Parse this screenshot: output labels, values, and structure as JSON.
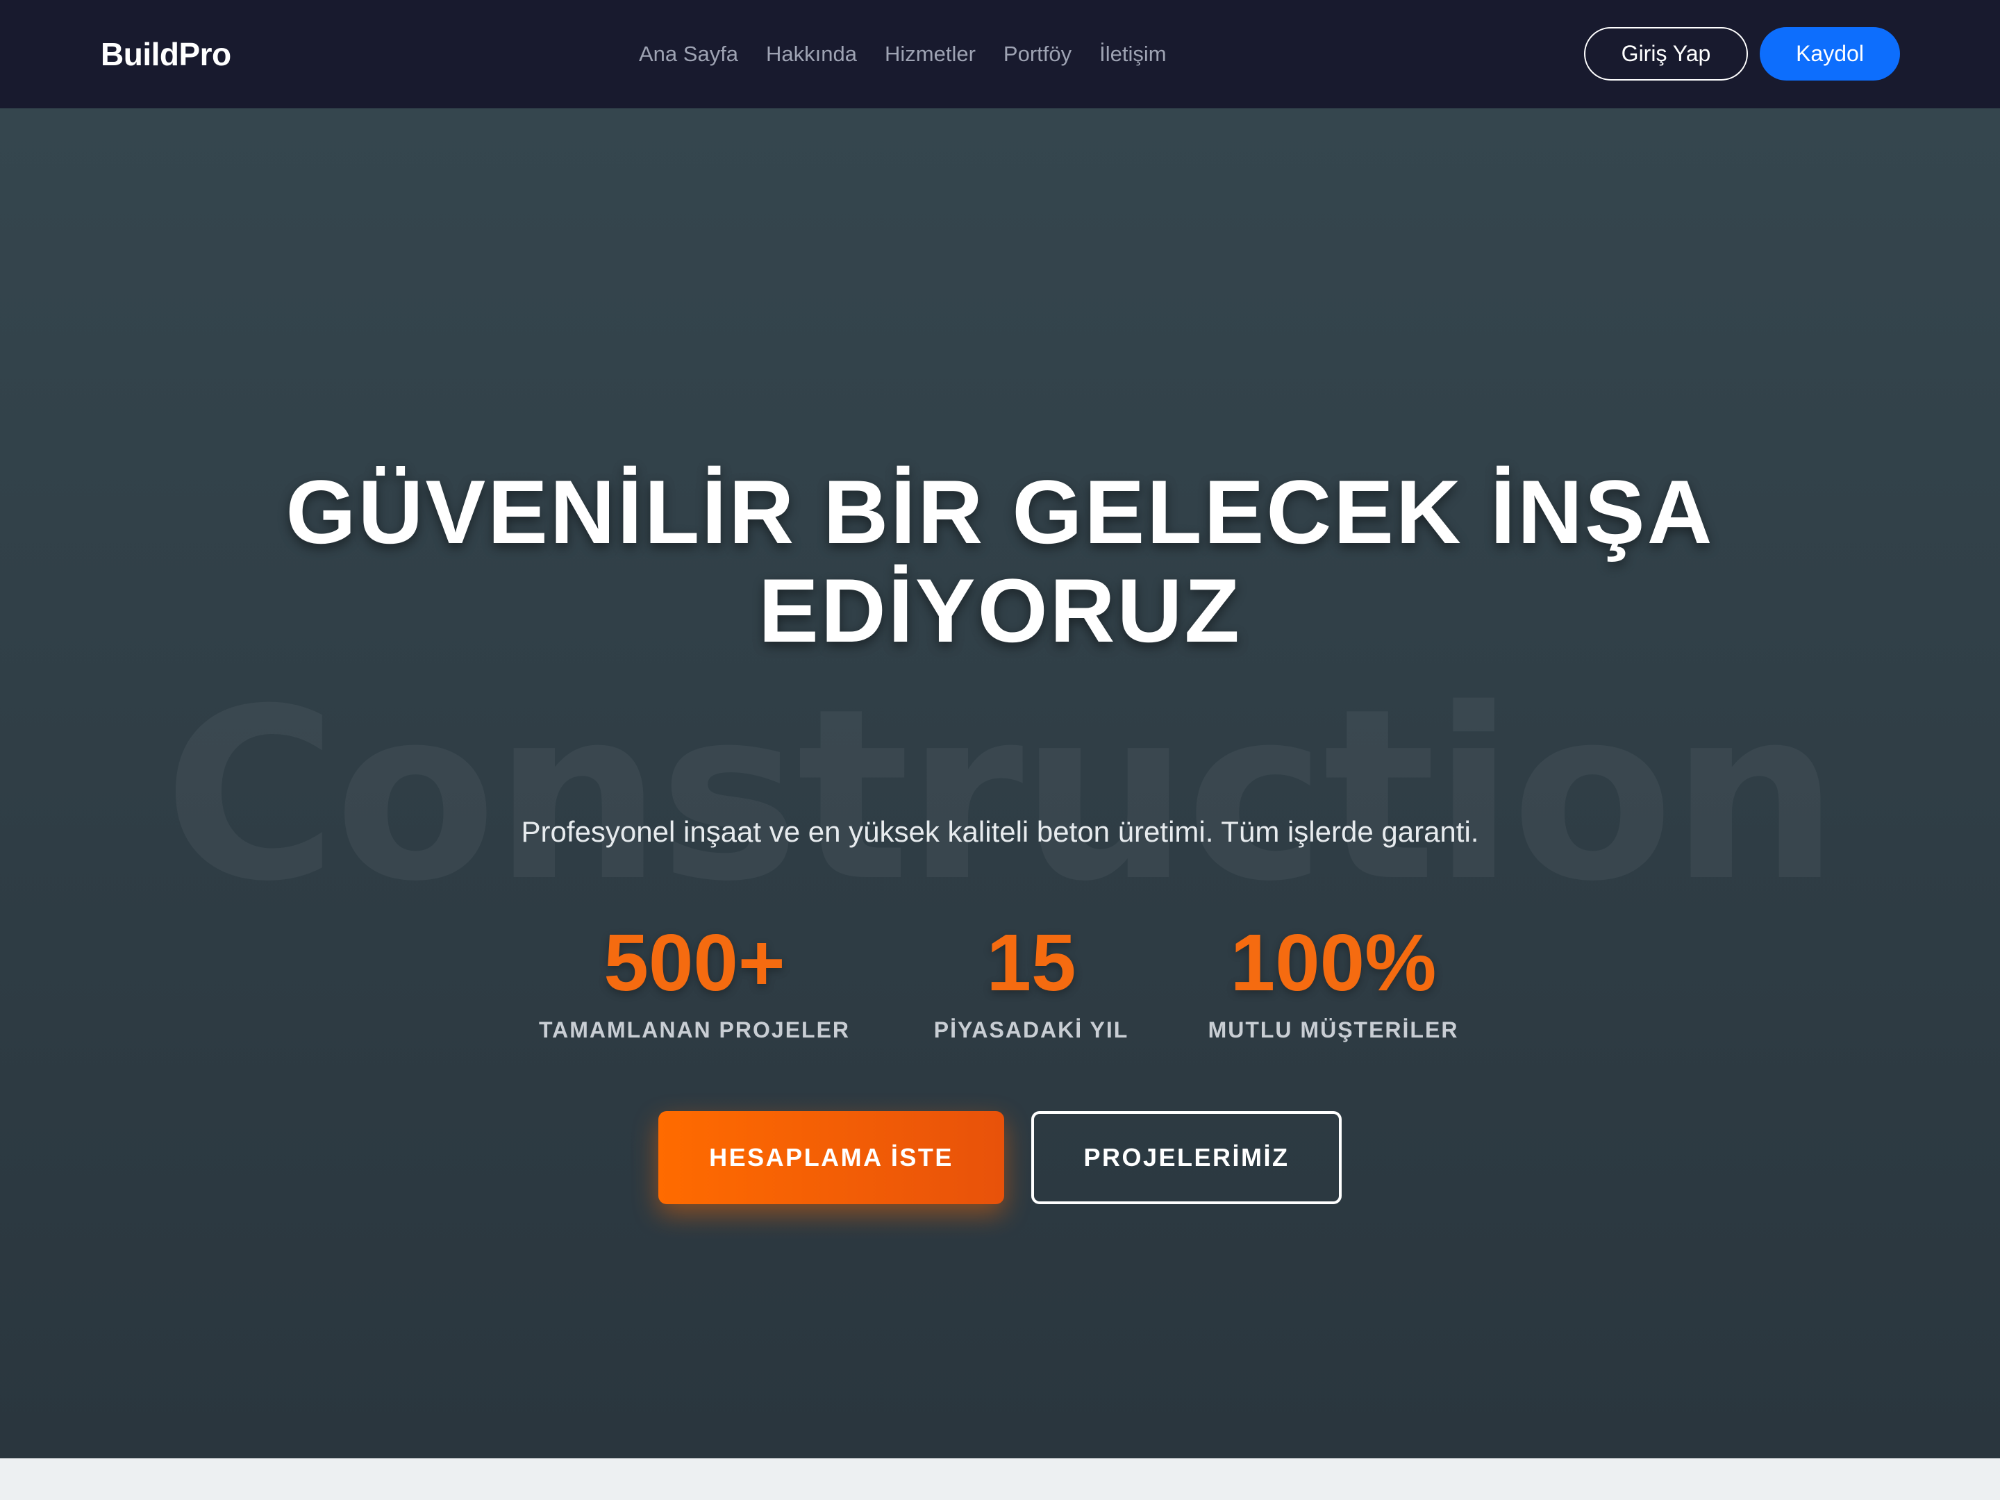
{
  "navbar": {
    "brand": "BuildPro",
    "links": [
      {
        "label": "Ana Sayfa"
      },
      {
        "label": "Hakkında"
      },
      {
        "label": "Hizmetler"
      },
      {
        "label": "Portföy"
      },
      {
        "label": "İletişim"
      }
    ],
    "login_label": "Giriş Yap",
    "signup_label": "Kaydol"
  },
  "hero": {
    "watermark": "Construction",
    "title_line1": "GÜVENİLİR BİR GELECEK İNŞA",
    "title_line2": "EDİYORUZ",
    "subtitle": "Profesyonel inşaat ve en yüksek kaliteli beton üretimi. Tüm işlerde garanti.",
    "stats": [
      {
        "value": "500+",
        "label": "TAMAMLANAN PROJELER"
      },
      {
        "value": "15",
        "label": "PİYASADAKİ YIL"
      },
      {
        "value": "100%",
        "label": "MUTLU MÜŞTERİLER"
      }
    ],
    "primary_button": "HESAPLAMA İSTE",
    "secondary_button": "PROJELERİMİZ"
  },
  "colors": {
    "navbar_bg": "#181a2e",
    "accent_orange": "#f56b10",
    "signup_blue": "#0d6efd",
    "hero_bg": "#33434b"
  }
}
